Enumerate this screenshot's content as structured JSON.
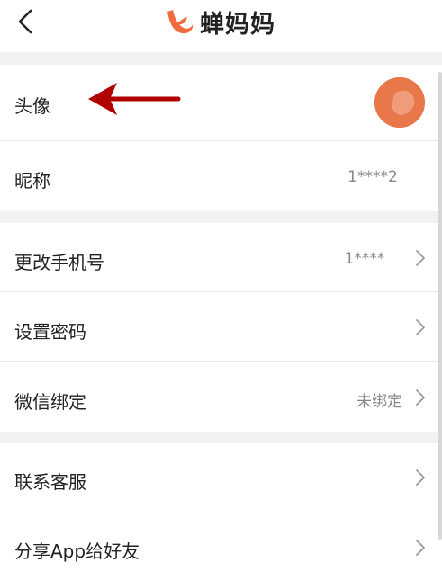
{
  "header": {
    "title": "蝉妈妈",
    "back_icon": "chevron-left-icon",
    "logo_icon": "chanmama-logo-icon"
  },
  "colors": {
    "brand": "#f06b3d",
    "annotation_arrow": "#b00000"
  },
  "rows": {
    "avatar": {
      "label": "头像"
    },
    "nickname": {
      "label": "昵称",
      "value": "1****2"
    },
    "phone": {
      "label": "更改手机号",
      "value": "1****"
    },
    "password": {
      "label": "设置密码"
    },
    "wechat": {
      "label": "微信绑定",
      "value": "未绑定"
    },
    "service": {
      "label": "联系客服"
    },
    "share": {
      "label": "分享App给好友"
    }
  }
}
